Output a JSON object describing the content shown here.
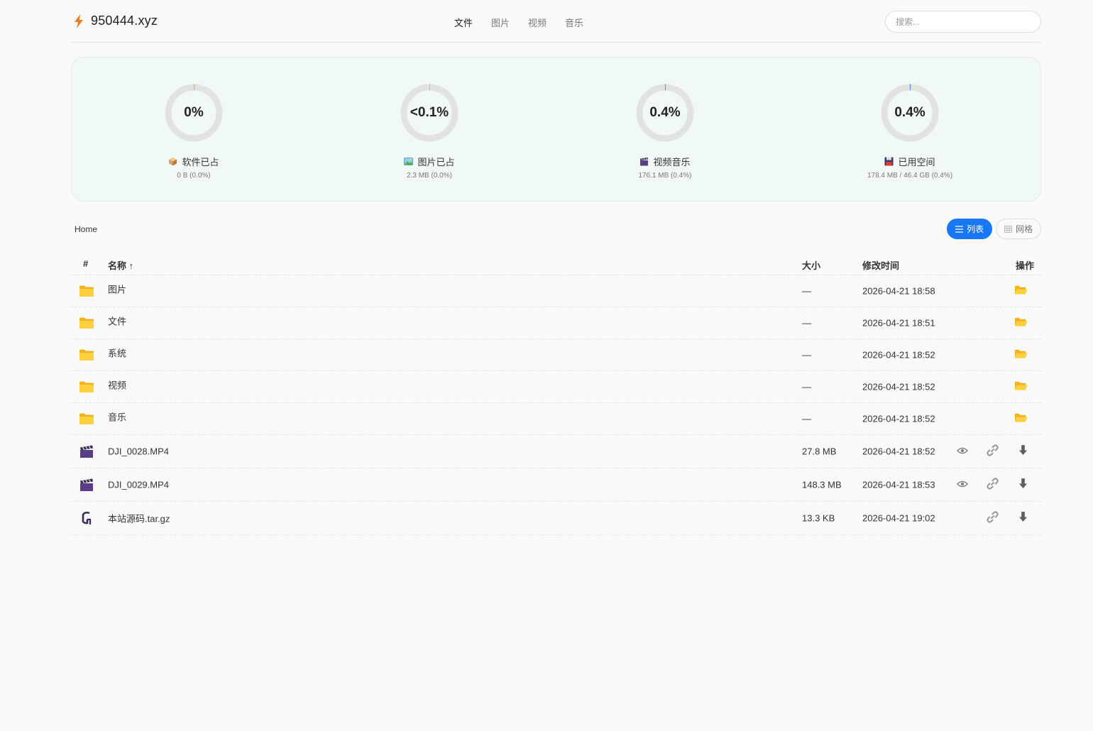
{
  "header": {
    "brand": "950444.xyz",
    "nav": [
      "文件",
      "图片",
      "视频",
      "音乐"
    ],
    "active_nav": 0,
    "search_placeholder": "搜索..."
  },
  "stats": [
    {
      "percent_text": "0%",
      "fraction": 0.0,
      "color": "#f0a030",
      "label": "软件已占",
      "icon": "package-icon",
      "sub": "0 B (0.0%)"
    },
    {
      "percent_text": "<0.1%",
      "fraction": 0.0005,
      "color": "#b0b0b0",
      "label": "图片已占",
      "icon": "picture-icon",
      "sub": "2.3 MB (0.0%)"
    },
    {
      "percent_text": "0.4%",
      "fraction": 0.004,
      "color": "#3aa655",
      "label": "视频音乐",
      "icon": "clapper-icon",
      "sub": "176.1 MB (0.4%)"
    },
    {
      "percent_text": "0.4%",
      "fraction": 0.004,
      "color": "#2f6fe0",
      "label": "已用空间",
      "icon": "floppy-disk-icon",
      "sub": "178.4 MB / 46.4 GB (0.4%)"
    }
  ],
  "breadcrumb": "Home",
  "view_toggle": {
    "list": "列表",
    "grid": "网格",
    "active": "list"
  },
  "table": {
    "headers": {
      "index": "#",
      "name": "名称 ↑",
      "size": "大小",
      "modified": "修改时间",
      "actions": "操作"
    },
    "rows": [
      {
        "type": "folder",
        "name": "图片",
        "size": "—",
        "modified": "2026-04-21 18:58"
      },
      {
        "type": "folder",
        "name": "文件",
        "size": "—",
        "modified": "2026-04-21 18:51"
      },
      {
        "type": "folder",
        "name": "系统",
        "size": "—",
        "modified": "2026-04-21 18:52"
      },
      {
        "type": "folder",
        "name": "视频",
        "size": "—",
        "modified": "2026-04-21 18:52"
      },
      {
        "type": "folder",
        "name": "音乐",
        "size": "—",
        "modified": "2026-04-21 18:52"
      },
      {
        "type": "video",
        "name": "DJI_0028.MP4",
        "size": "27.8 MB",
        "modified": "2026-04-21 18:52",
        "preview": true
      },
      {
        "type": "video",
        "name": "DJI_0029.MP4",
        "size": "148.3 MB",
        "modified": "2026-04-21 18:53",
        "preview": true
      },
      {
        "type": "archive",
        "name": "本站源码.tar.gz",
        "size": "13.3 KB",
        "modified": "2026-04-21 19:02",
        "preview": false
      }
    ]
  },
  "colors": {
    "accent": "#1877f2",
    "brand_bolt": "#f57c1f",
    "folder": "#f9c531",
    "panel_bg": "#f1f9f7"
  }
}
